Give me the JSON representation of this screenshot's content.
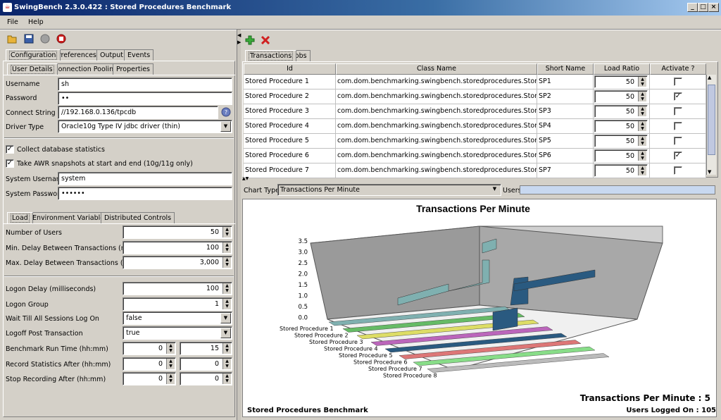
{
  "window": {
    "title": "SwingBench 2.3.0.422 : Stored Procedures Benchmark",
    "minimize_label": "_",
    "maximize_label": "□",
    "close_label": "×"
  },
  "menu": {
    "file": "File",
    "help": "Help"
  },
  "toolbar": {
    "open_icon": "folder-icon",
    "save_icon": "save-icon",
    "start_icon": "start-icon",
    "stop_icon": "stop-icon"
  },
  "left_tabs": [
    "Configuration",
    "Preferences",
    "Output",
    "Events"
  ],
  "sub_tabs": [
    "User Details",
    "Connection Pooling",
    "Properties"
  ],
  "user_details": {
    "username_label": "Username",
    "username": "sh",
    "password_label": "Password",
    "password": "••",
    "connect_label": "Connect String",
    "connect": "//192.168.0.136/tpcdb",
    "driver_label": "Driver Type",
    "driver": "Oracle10g Type IV jdbc driver (thin)",
    "collect_stats": "Collect database statistics",
    "awr": "Take AWR snapshots at start and end (10g/11g only)",
    "sys_user_label": "System Username",
    "sys_user": "system",
    "sys_pass_label": "System Password",
    "sys_pass": "••••••"
  },
  "load_tabs": [
    "Load",
    "Environment Variables",
    "Distributed Controls"
  ],
  "load": {
    "users_label": "Number of Users",
    "users": "50",
    "min_delay_label": "Min. Delay Between Transactions (ms)",
    "min_delay": "100",
    "max_delay_label": "Max. Delay Between Transactions (ms)",
    "max_delay": "3,000",
    "logon_delay_label": "Logon Delay (milliseconds)",
    "logon_delay": "100",
    "logon_group_label": "Logon Group",
    "logon_group": "1",
    "wait_label": "Wait Till All Sessions Log On",
    "wait": "false",
    "logoff_label": "Logoff Post Transaction",
    "logoff": "true",
    "runtime_label": "Benchmark Run Time (hh:mm)",
    "runtime_h": "0",
    "runtime_m": "15",
    "record_label": "Record Statistics After (hh:mm)",
    "record_h": "0",
    "record_m": "0",
    "stop_label": "Stop Recording After (hh:mm)",
    "stop_h": "0",
    "stop_m": "0"
  },
  "right_toolbar": {
    "add_icon": "add-icon",
    "delete_icon": "delete-icon"
  },
  "right_tabs": [
    "Transactions",
    "Jobs"
  ],
  "grid": {
    "headers": [
      "Id",
      "Class Name",
      "Short Name",
      "Load Ratio",
      "Activate ?"
    ],
    "rows": [
      {
        "id": "Stored Procedure 1",
        "cls": "com.dom.benchmarking.swingbench.storedprocedures.StoredProc...",
        "short": "SP1",
        "ratio": "50",
        "active": ""
      },
      {
        "id": "Stored Procedure 2",
        "cls": "com.dom.benchmarking.swingbench.storedprocedures.StoredProc...",
        "short": "SP2",
        "ratio": "50",
        "active": "✓"
      },
      {
        "id": "Stored Procedure 3",
        "cls": "com.dom.benchmarking.swingbench.storedprocedures.StoredProc...",
        "short": "SP3",
        "ratio": "50",
        "active": ""
      },
      {
        "id": "Stored Procedure 4",
        "cls": "com.dom.benchmarking.swingbench.storedprocedures.StoredProc...",
        "short": "SP4",
        "ratio": "50",
        "active": ""
      },
      {
        "id": "Stored Procedure 5",
        "cls": "com.dom.benchmarking.swingbench.storedprocedures.StoredProc...",
        "short": "SP5",
        "ratio": "50",
        "active": ""
      },
      {
        "id": "Stored Procedure 6",
        "cls": "com.dom.benchmarking.swingbench.storedprocedures.StoredProc...",
        "short": "SP6",
        "ratio": "50",
        "active": "✓"
      },
      {
        "id": "Stored Procedure 7",
        "cls": "com.dom.benchmarking.swingbench.storedprocedures.StoredProc...",
        "short": "SP7",
        "ratio": "50",
        "active": ""
      }
    ]
  },
  "chart_controls": {
    "type_label": "Chart Type",
    "type_value": "Transactions Per Minute",
    "users_label": "Users"
  },
  "chart": {
    "title": "Transactions Per Minute",
    "y_ticks": [
      "3.5",
      "3.0",
      "2.5",
      "2.0",
      "1.5",
      "1.0",
      "0.5",
      "0.0"
    ],
    "series_labels": [
      "Stored Procedure 1",
      "Stored Procedure 2",
      "Stored Procedure 3",
      "Stored Procedure 4",
      "Stored Procedure 5",
      "Stored Procedure 6",
      "Stored Procedure 7",
      "Stored Procedure 8"
    ],
    "series_colors": [
      "#7fb0b0",
      "#66bb66",
      "#dddd66",
      "#bb66bb",
      "#2a5a80",
      "#dd7777",
      "#88dd88",
      "#bbbbbb"
    ],
    "footer_left": "Stored Procedures Benchmark",
    "tpm_readout": "Transactions Per Minute : 5",
    "users_readout": "Users Logged On : 105"
  }
}
